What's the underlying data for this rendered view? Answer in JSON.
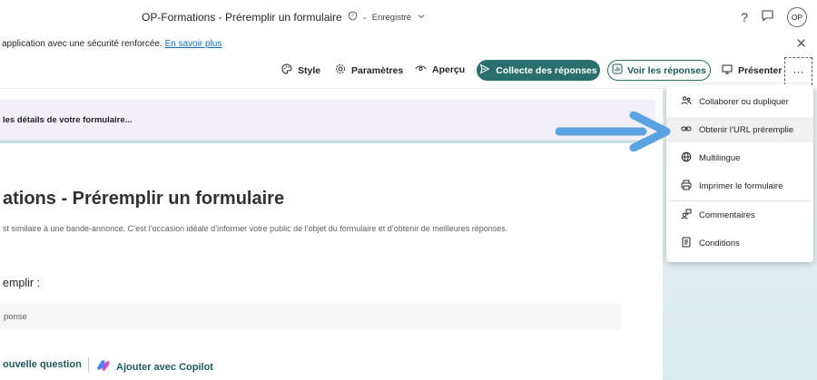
{
  "titlebar": {
    "title": "OP-Formations - Préremplir un formulaire",
    "separator": "-",
    "status": "Enregistré",
    "help": "?",
    "avatar": "OP"
  },
  "banner": {
    "text": "application avec une sécurité renforcée. ",
    "link": "En savoir plus"
  },
  "toolbar": {
    "style": "Style",
    "settings": "Paramètres",
    "preview": "Aperçu",
    "collect": "Collecte des réponses",
    "responses": "Voir les réponses",
    "present": "Présenter",
    "more": "···"
  },
  "form": {
    "detail_bar": "les détails de votre formulaire...",
    "title": "ations - Préremplir un formulaire",
    "description": "st similaire à une bande-annonce. C’est l’occasion idéale d’informer votre public de l’objet du formulaire et d’obtenir de meilleures réponses.",
    "question_label": "emplir :",
    "answer_placeholder": "ponse",
    "new_question": "ouvelle question",
    "copilot": "Ajouter avec Copilot"
  },
  "menu": {
    "items": [
      {
        "label": "Collaborer ou dupliquer",
        "icon": "collaborate-icon"
      },
      {
        "label": "Obtenir l’URL préremplie",
        "icon": "link-icon"
      },
      {
        "label": "Multilingue",
        "icon": "globe-icon"
      },
      {
        "label": "Imprimer le formulaire",
        "icon": "print-icon"
      },
      {
        "label": "Commentaires",
        "icon": "feedback-icon"
      },
      {
        "label": "Conditions",
        "icon": "document-icon"
      }
    ]
  },
  "colors": {
    "accent": "#2b6e6e",
    "arrow": "#5aa3e0",
    "detail_bar": "#f1eef7"
  }
}
